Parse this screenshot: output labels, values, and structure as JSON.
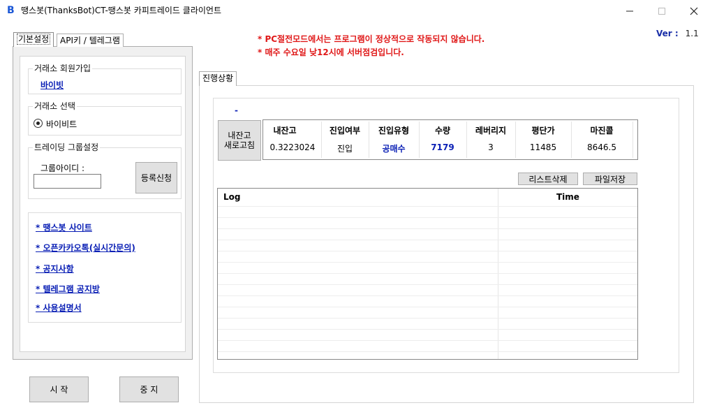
{
  "window": {
    "title": "땡스봇(ThanksBot)CT-땡스봇 카피트레이드 클라이언트",
    "icon": "thanksbot-logo-icon",
    "min_glyph": "—",
    "max_glyph": "☐",
    "close_glyph": "✕"
  },
  "notices": {
    "line1": "* PC절전모드에서는 프로그램이 정상적으로 작동되지 않습니다.",
    "line2": "* 매주 수요일 낮12시에 서버점검입니다."
  },
  "version": {
    "label": "Ver :",
    "value": "1.1"
  },
  "left_tabs": {
    "basic": "기본설정",
    "api": "API키 / 텔레그램"
  },
  "exchange_join": {
    "title": "거래소 회원가입",
    "link": "바이빗"
  },
  "exchange_select": {
    "title": "거래소 선택",
    "option": "바이비트"
  },
  "trading_group": {
    "title": "트레이딩 그룹설정",
    "id_label": "그룹아이디 :",
    "id_value": "",
    "register_button": "등록신청"
  },
  "links": [
    "* 땡스봇 사이트",
    "* 오픈카카오톡(실시간문의)",
    "* 공지사항",
    "* 텔레그램 공지방",
    "* 사용설명서"
  ],
  "controls": {
    "start": "시 작",
    "stop": "중 지"
  },
  "right_tabs": {
    "progress": "진행상황"
  },
  "status_marker": "-",
  "refresh_button": "내잔고\n새로고침",
  "status_table": {
    "headers": [
      "내잔고",
      "진입여부",
      "진입유형",
      "수량",
      "레버리지",
      "평단가",
      "마진콜"
    ],
    "values": [
      "0.3223024",
      "진입",
      "공매수",
      "7179",
      "3",
      "11485",
      "8646.5"
    ]
  },
  "list_buttons": {
    "clear": "리스트삭제",
    "save": "파일저장"
  },
  "log": {
    "col_log": "Log",
    "col_time": "Time"
  }
}
